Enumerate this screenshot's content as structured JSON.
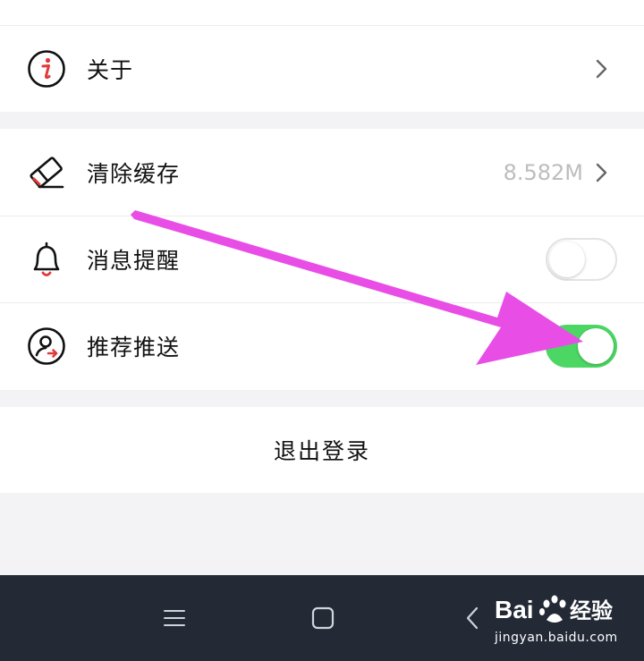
{
  "settings": {
    "about": {
      "label": "关于",
      "icon": "info-icon"
    },
    "clear_cache": {
      "label": "清除缓存",
      "value": "8.582M",
      "icon": "eraser-icon"
    },
    "notifications": {
      "label": "消息提醒",
      "icon": "bell-icon",
      "enabled": false
    },
    "recommend_push": {
      "label": "推荐推送",
      "icon": "user-push-icon",
      "enabled": true
    }
  },
  "logout": {
    "label": "退出登录"
  },
  "watermark": {
    "brand": "Bai经验",
    "url": "jingyan.baidu.com"
  },
  "colors": {
    "toggle_on": "#4cd764",
    "arrow": "#e84ee6",
    "navbar": "#232a36",
    "info_red": "#e03a3a"
  }
}
